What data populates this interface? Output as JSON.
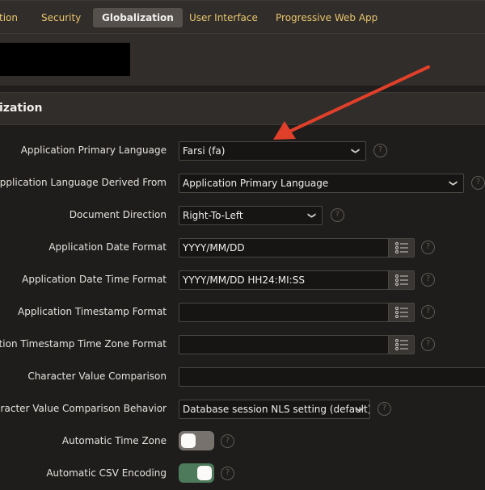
{
  "tabs": [
    {
      "label": "tion"
    },
    {
      "label": "Security"
    },
    {
      "label": "Globalization",
      "active": true
    },
    {
      "label": "User Interface"
    },
    {
      "label": "Progressive Web App"
    }
  ],
  "section": {
    "title": "ization"
  },
  "fields": {
    "primary_language": {
      "label": "Application Primary Language",
      "value": "Farsi (fa)"
    },
    "derived_from": {
      "label": "Application Language Derived From",
      "value": "Application Primary Language"
    },
    "direction": {
      "label": "Document Direction",
      "value": "Right-To-Left"
    },
    "date_format": {
      "label": "Application Date Format",
      "value": "YYYY/MM/DD"
    },
    "date_time_format": {
      "label": "Application Date Time Format",
      "value": "YYYY/MM/DD HH24:MI:SS"
    },
    "timestamp_format": {
      "label": "Application Timestamp Format",
      "value": ""
    },
    "timestamp_tz_format": {
      "label": "lication Timestamp Time Zone Format",
      "value": ""
    },
    "char_comparison": {
      "label": "Character Value Comparison",
      "value": ""
    },
    "char_comparison_behavior": {
      "label": "Character Value Comparison Behavior",
      "value": "Database session NLS setting (default)"
    },
    "auto_timezone": {
      "label": "Automatic Time Zone",
      "on": false
    },
    "auto_csv": {
      "label": "Automatic CSV Encoding",
      "on": true
    }
  },
  "help_symbol": "?",
  "colors": {
    "tab_text": "#e8c66d",
    "toggle_on": "#4d7a5b",
    "toggle_off": "#77726d",
    "arrow": "#e0402a"
  }
}
